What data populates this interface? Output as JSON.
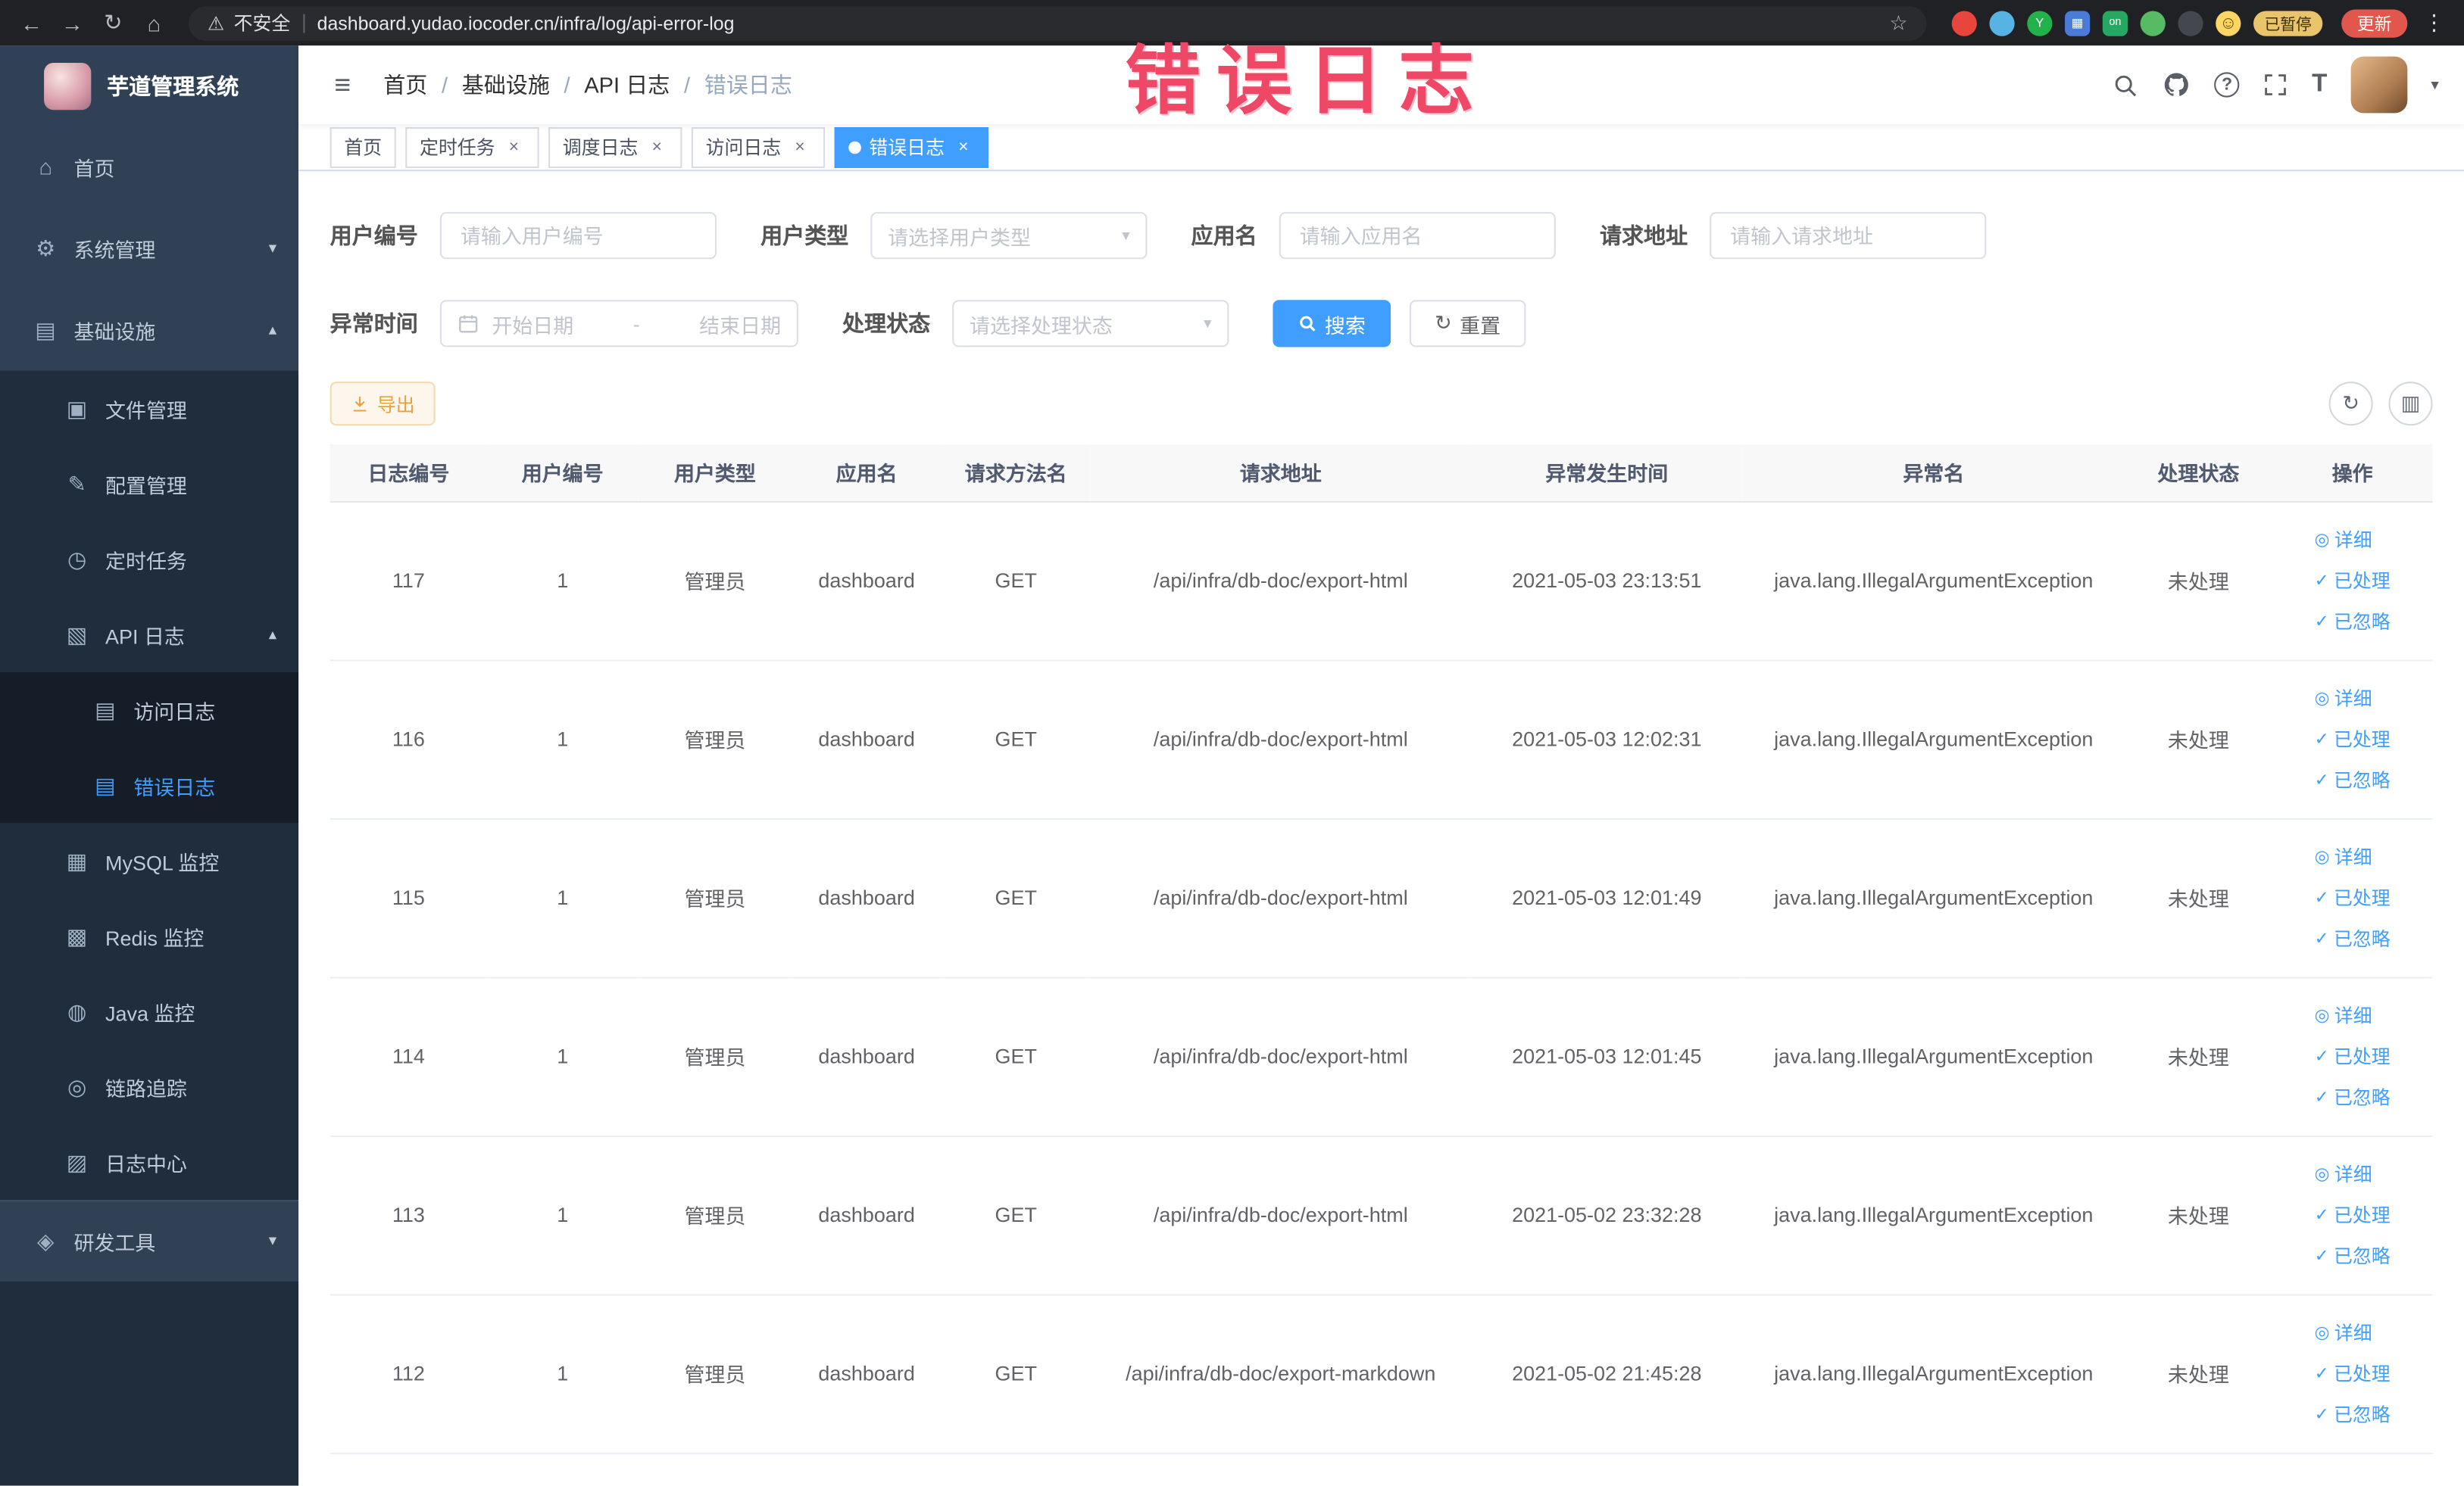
{
  "colors": {
    "accent": "#409eff",
    "chrome_bg": "#1f2125",
    "sidebar_bg": "#304156",
    "sidebar_submenu_bg": "#1f2d3d",
    "annotation_red": "#ee4866",
    "warning_button": "#e6a23c",
    "active_tab_bg": "#409eff"
  },
  "annotation": {
    "text": "错误日志"
  },
  "browser": {
    "security_label": "不安全",
    "url": "dashboard.yudao.iocoder.cn/infra/log/api-error-log",
    "paused_badge": "已暂停",
    "update_button": "更新"
  },
  "icons": {
    "back": "←",
    "forward": "→",
    "reload": "↻",
    "home": "⌂",
    "warning": "⚠",
    "star": "☆",
    "overflow_menu": "⋮",
    "hamburger": "≡",
    "breadcrumb_sep": "/",
    "chevron_down": "▾",
    "chevron_up": "▴",
    "select_caret": "▾",
    "avatar_caret": "▾",
    "question": "?",
    "font_size": "T",
    "close": "×",
    "smiley": "☺",
    "ext_y": "Y",
    "ext_grid": "▦",
    "ext_on": "on",
    "menu_home": "⌂",
    "menu_system": "⚙",
    "menu_infra": "▤",
    "menu_file": "▣",
    "menu_config": "✎",
    "menu_job": "◷",
    "menu_apilog": "▧",
    "menu_accesslog": "▤",
    "menu_errorlog": "▤",
    "menu_mysql": "▦",
    "menu_redis": "▩",
    "menu_java": "◍",
    "menu_trace": "◎",
    "menu_logcenter": "▨",
    "menu_devtools": "◈",
    "eye": "◎",
    "check": "✓",
    "refresh": "↻",
    "columns": "▥",
    "date_separator": "-"
  },
  "sidebar": {
    "logo_title": "芋道管理系统",
    "items": [
      {
        "label": "首页"
      },
      {
        "label": "系统管理"
      },
      {
        "label": "基础设施"
      },
      {
        "label": "文件管理"
      },
      {
        "label": "配置管理"
      },
      {
        "label": "定时任务"
      },
      {
        "label": "API 日志"
      },
      {
        "label": "访问日志"
      },
      {
        "label": "错误日志"
      },
      {
        "label": "MySQL 监控"
      },
      {
        "label": "Redis 监控"
      },
      {
        "label": "Java 监控"
      },
      {
        "label": "链路追踪"
      },
      {
        "label": "日志中心"
      },
      {
        "label": "研发工具"
      }
    ]
  },
  "header": {
    "breadcrumb": [
      "首页",
      "基础设施",
      "API 日志",
      "错误日志"
    ]
  },
  "tabs": [
    {
      "label": "首页"
    },
    {
      "label": "定时任务"
    },
    {
      "label": "调度日志"
    },
    {
      "label": "访问日志"
    },
    {
      "label": "错误日志"
    }
  ],
  "filters": {
    "user_id": {
      "label": "用户编号",
      "placeholder": "请输入用户编号"
    },
    "user_type": {
      "label": "用户类型",
      "placeholder": "请选择用户类型"
    },
    "app_name": {
      "label": "应用名",
      "placeholder": "请输入应用名"
    },
    "request_url": {
      "label": "请求地址",
      "placeholder": "请输入请求地址"
    },
    "exception_time": {
      "label": "异常时间",
      "start_placeholder": "开始日期",
      "end_placeholder": "结束日期"
    },
    "process_status": {
      "label": "处理状态",
      "placeholder": "请选择处理状态"
    },
    "search_button": "搜索",
    "reset_button": "重置"
  },
  "toolbar": {
    "export_button": "导出"
  },
  "table": {
    "columns": [
      "日志编号",
      "用户编号",
      "用户类型",
      "应用名",
      "请求方法名",
      "请求地址",
      "异常发生时间",
      "异常名",
      "处理状态",
      "操作"
    ],
    "actions": [
      "详细",
      "已处理",
      "已忽略"
    ],
    "rows": [
      [
        "117",
        "1",
        "管理员",
        "dashboard",
        "GET",
        "/api/infra/db-doc/export-html",
        "2021-05-03 23:13:51",
        "java.lang.IllegalArgumentException",
        "未处理"
      ],
      [
        "116",
        "1",
        "管理员",
        "dashboard",
        "GET",
        "/api/infra/db-doc/export-html",
        "2021-05-03 12:02:31",
        "java.lang.IllegalArgumentException",
        "未处理"
      ],
      [
        "115",
        "1",
        "管理员",
        "dashboard",
        "GET",
        "/api/infra/db-doc/export-html",
        "2021-05-03 12:01:49",
        "java.lang.IllegalArgumentException",
        "未处理"
      ],
      [
        "114",
        "1",
        "管理员",
        "dashboard",
        "GET",
        "/api/infra/db-doc/export-html",
        "2021-05-03 12:01:45",
        "java.lang.IllegalArgumentException",
        "未处理"
      ],
      [
        "113",
        "1",
        "管理员",
        "dashboard",
        "GET",
        "/api/infra/db-doc/export-html",
        "2021-05-02 23:32:28",
        "java.lang.IllegalArgumentException",
        "未处理"
      ],
      [
        "112",
        "1",
        "管理员",
        "dashboard",
        "GET",
        "/api/infra/db-doc/export-markdown",
        "2021-05-02 21:45:28",
        "java.lang.IllegalArgumentException",
        "未处理"
      ]
    ]
  }
}
